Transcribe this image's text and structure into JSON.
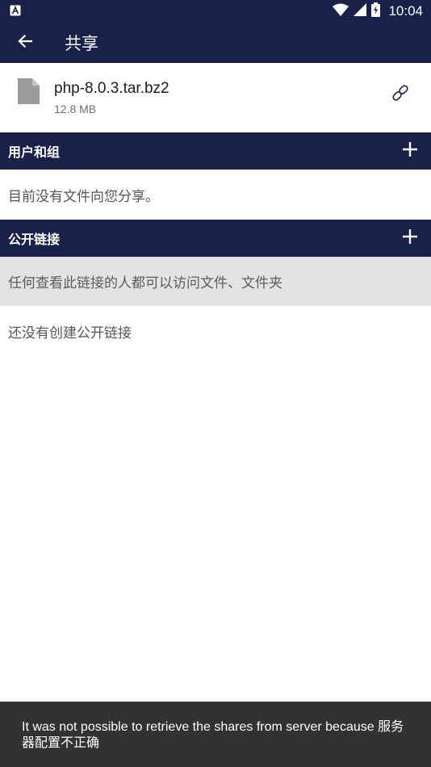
{
  "status_bar": {
    "time": "10:04",
    "icons": [
      "app-notification-icon",
      "wifi-icon",
      "signal-icon",
      "battery-icon"
    ]
  },
  "toolbar": {
    "back_icon": "arrow-back-icon",
    "title": "共享"
  },
  "file": {
    "name": "php-8.0.3.tar.bz2",
    "size": "12.8 MB",
    "icon": "file-icon",
    "action_icon": "link-icon"
  },
  "users_groups": {
    "header": "用户和组",
    "add_icon": "plus-icon",
    "empty_text": "目前没有文件向您分享。"
  },
  "public_links": {
    "header": "公开链接",
    "add_icon": "plus-icon",
    "hint": "任何查看此链接的人都可以访问文件、文件夹",
    "empty_text": "还没有创建公开链接"
  },
  "snackbar": {
    "message": "It was not possible to retrieve the shares from server because 服务器配置不正确"
  },
  "colors": {
    "primary": "#1a2148",
    "hint_background": "#e3e3e3",
    "snackbar_background": "#323232"
  }
}
